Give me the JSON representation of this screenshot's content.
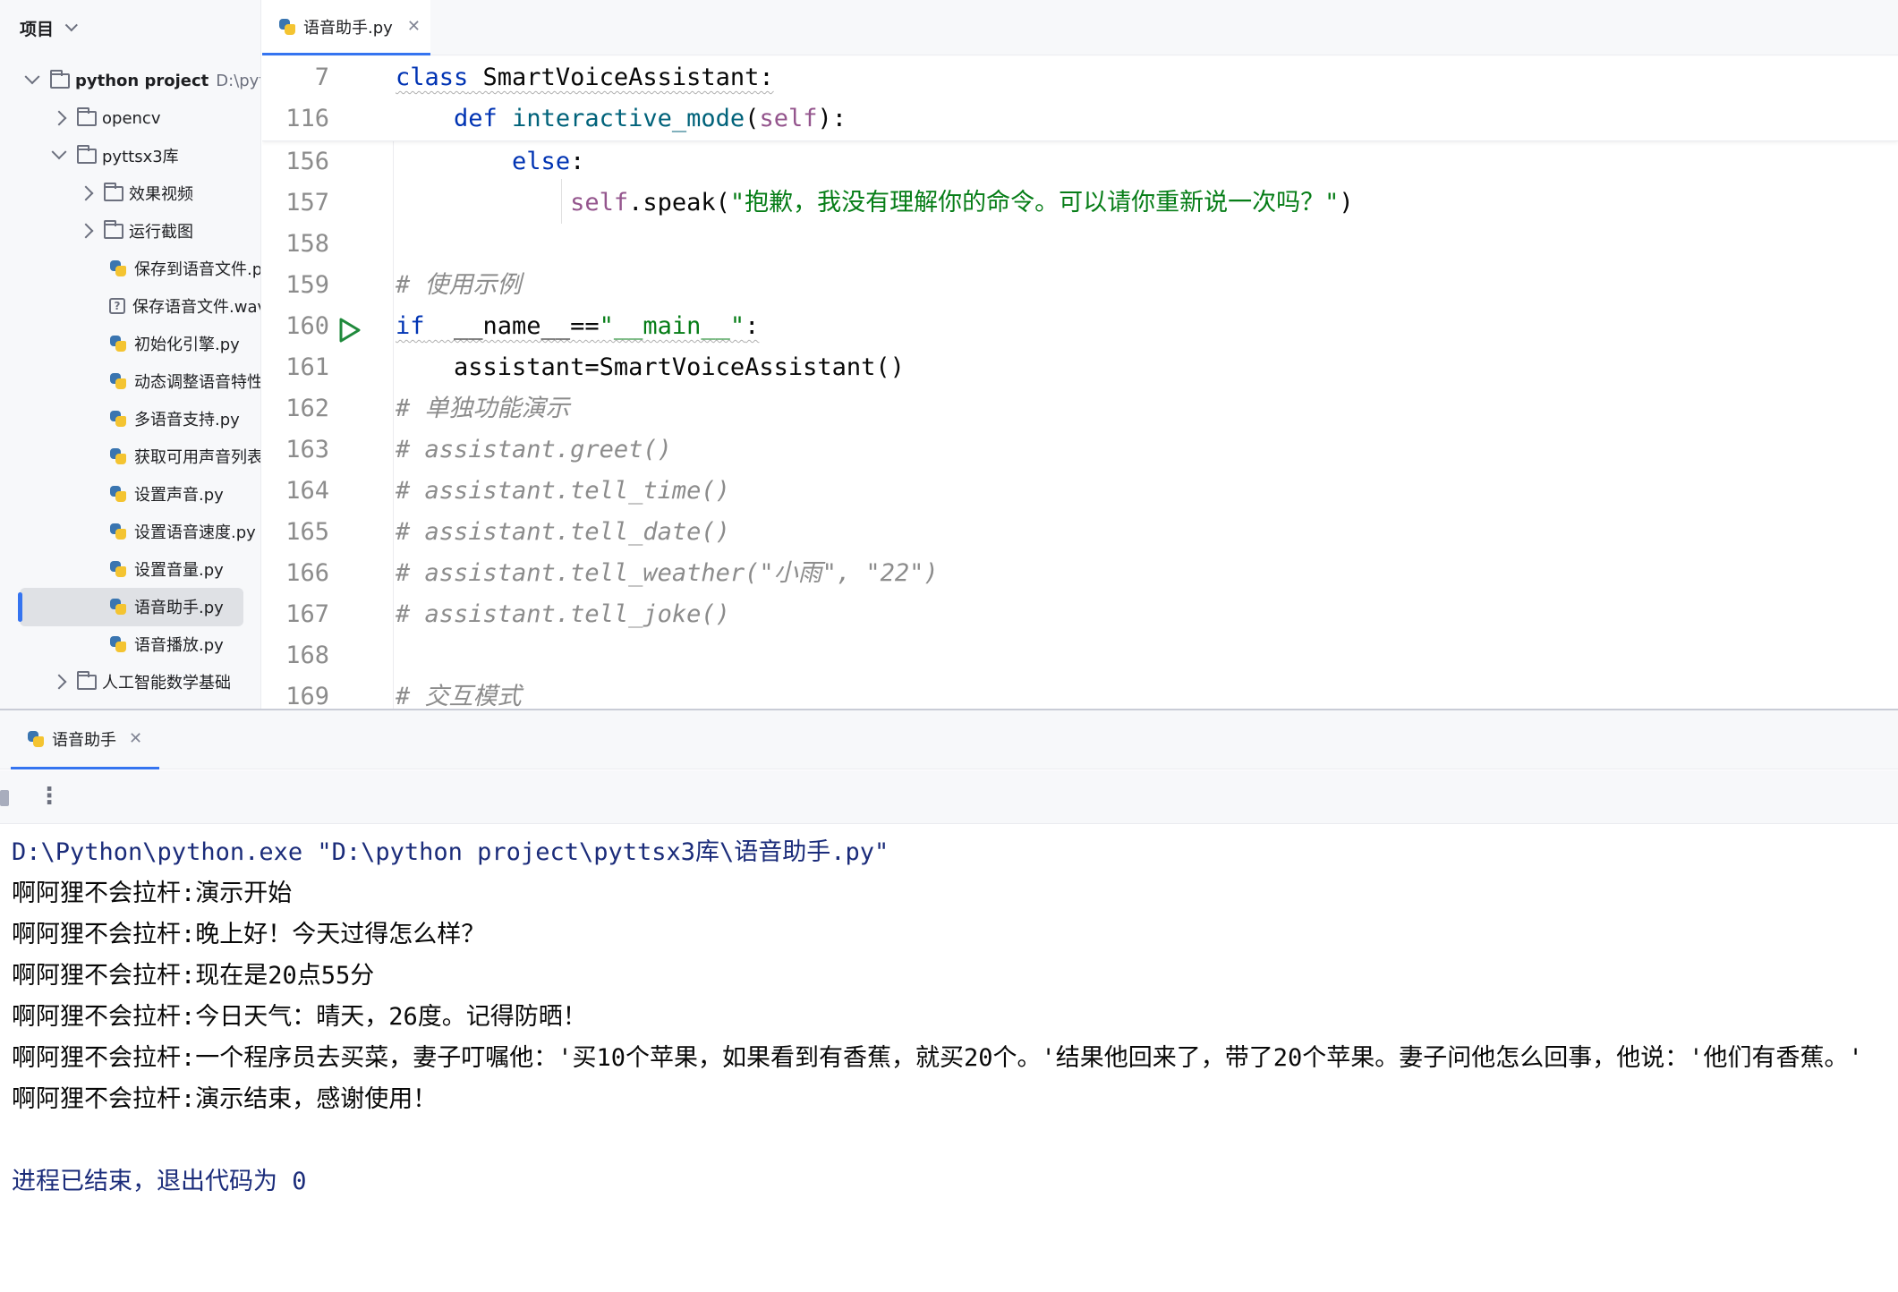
{
  "sidebar": {
    "title": "项目",
    "tree": [
      {
        "name": "python project",
        "hint": "D:\\python",
        "type": "folder",
        "state": "expanded",
        "depth": 0
      },
      {
        "name": "opencv",
        "type": "folder",
        "state": "collapsed",
        "depth": 1
      },
      {
        "name": "pyttsx3库",
        "type": "folder",
        "state": "expanded",
        "depth": 1
      },
      {
        "name": "效果视频",
        "type": "folder",
        "state": "collapsed",
        "depth": 2
      },
      {
        "name": "运行截图",
        "type": "folder",
        "state": "collapsed",
        "depth": 2
      },
      {
        "name": "保存到语音文件.py",
        "type": "python",
        "depth": 2
      },
      {
        "name": "保存语音文件.wav",
        "type": "unknown",
        "depth": 2
      },
      {
        "name": "初始化引擎.py",
        "type": "python",
        "depth": 2
      },
      {
        "name": "动态调整语音特性.py",
        "type": "python",
        "depth": 2
      },
      {
        "name": "多语音支持.py",
        "type": "python",
        "depth": 2
      },
      {
        "name": "获取可用声音列表.py",
        "type": "python",
        "depth": 2
      },
      {
        "name": "设置声音.py",
        "type": "python",
        "depth": 2
      },
      {
        "name": "设置语音速度.py",
        "type": "python",
        "depth": 2
      },
      {
        "name": "设置音量.py",
        "type": "python",
        "depth": 2
      },
      {
        "name": "语音助手.py",
        "type": "python",
        "depth": 2,
        "selected": true
      },
      {
        "name": "语音播放.py",
        "type": "python",
        "depth": 2
      },
      {
        "name": "人工智能数学基础",
        "type": "folder",
        "state": "collapsed",
        "depth": 1
      }
    ]
  },
  "editor": {
    "tab_label": "语音助手.py",
    "sticky": [
      {
        "ln": "7",
        "tokens": [
          [
            "kw",
            "class"
          ],
          [
            "p",
            " SmartVoiceAssistant:"
          ]
        ]
      },
      {
        "ln": "116",
        "tokens": [
          [
            "p",
            "    "
          ],
          [
            "kw",
            "def"
          ],
          [
            "p",
            " "
          ],
          [
            "fn",
            "interactive_mode"
          ],
          [
            "p",
            "("
          ],
          [
            "self",
            "self"
          ],
          [
            "p",
            "):"
          ]
        ]
      }
    ],
    "lines": [
      {
        "ln": "156",
        "tokens": [
          [
            "p",
            "        "
          ],
          [
            "kw",
            "else"
          ],
          [
            "p",
            ":"
          ]
        ]
      },
      {
        "ln": "157",
        "tokens": [
          [
            "p",
            "            "
          ],
          [
            "self",
            "self"
          ],
          [
            "p",
            ".speak("
          ],
          [
            "str",
            "\"抱歉，我没有理解你的命令。可以请你重新说一次吗？\""
          ],
          [
            "p",
            ")"
          ]
        ]
      },
      {
        "ln": "158",
        "tokens": []
      },
      {
        "ln": "159",
        "tokens": [
          [
            "cmt",
            "# 使用示例"
          ]
        ]
      },
      {
        "ln": "160",
        "tokens": [
          [
            "kw",
            "if"
          ],
          [
            "p",
            "  __name__=="
          ],
          [
            "str",
            "\"__main__\""
          ],
          [
            "p",
            ":"
          ]
        ]
      },
      {
        "ln": "161",
        "tokens": [
          [
            "p",
            "    assistant=SmartVoiceAssistant()"
          ]
        ]
      },
      {
        "ln": "162",
        "tokens": [
          [
            "cmt",
            "# 单独功能演示"
          ]
        ]
      },
      {
        "ln": "163",
        "tokens": [
          [
            "cmt",
            "# assistant.greet()"
          ]
        ]
      },
      {
        "ln": "164",
        "tokens": [
          [
            "cmt",
            "# assistant.tell_time()"
          ]
        ]
      },
      {
        "ln": "165",
        "tokens": [
          [
            "cmt",
            "# assistant.tell_date()"
          ]
        ]
      },
      {
        "ln": "166",
        "tokens": [
          [
            "cmt",
            "# assistant.tell_weather(\"小雨\", \"22\")"
          ]
        ]
      },
      {
        "ln": "167",
        "tokens": [
          [
            "cmt",
            "# assistant.tell_joke()"
          ]
        ]
      },
      {
        "ln": "168",
        "tokens": []
      },
      {
        "ln": "169",
        "tokens": [
          [
            "cmt",
            "# 交互模式"
          ]
        ]
      }
    ]
  },
  "run_panel": {
    "tab_label": "语音助手",
    "console": [
      {
        "kind": "cmd",
        "text": "D:\\Python\\python.exe \"D:\\python project\\pyttsx3库\\语音助手.py\""
      },
      {
        "kind": "out",
        "text": "啊阿狸不会拉杆:演示开始"
      },
      {
        "kind": "out",
        "text": "啊阿狸不会拉杆:晚上好！今天过得怎么样？"
      },
      {
        "kind": "out",
        "text": "啊阿狸不会拉杆:现在是20点55分"
      },
      {
        "kind": "out",
        "text": "啊阿狸不会拉杆:今日天气：晴天，26度。记得防晒！"
      },
      {
        "kind": "out",
        "text": "啊阿狸不会拉杆:一个程序员去买菜，妻子叮嘱他：'买10个苹果，如果看到有香蕉，就买20个。'结果他回来了，带了20个苹果。妻子问他怎么回事，他说：'他们有香蕉。'"
      },
      {
        "kind": "out",
        "text": "啊阿狸不会拉杆:演示结束，感谢使用！"
      },
      {
        "kind": "blank",
        "text": ""
      },
      {
        "kind": "exit",
        "text": "进程已结束，退出代码为 0"
      }
    ]
  }
}
